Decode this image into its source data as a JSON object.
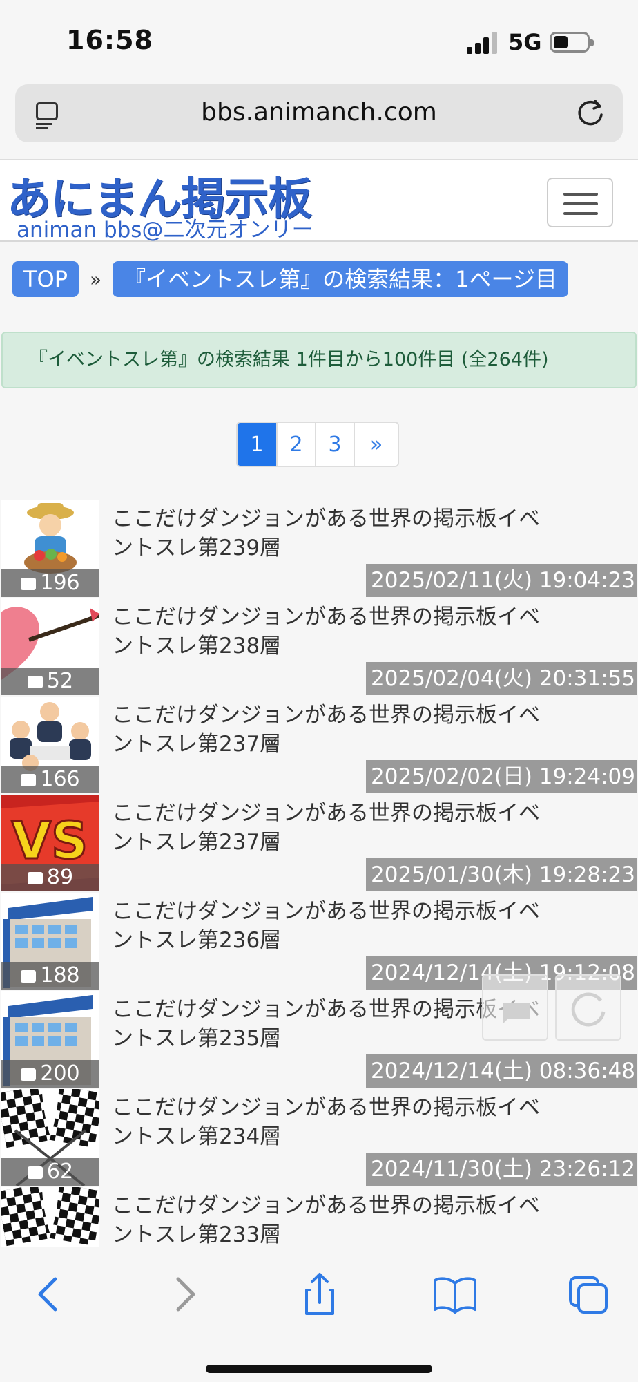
{
  "status": {
    "time": "16:58",
    "network": "5G"
  },
  "browser": {
    "url": "bbs.animanch.com"
  },
  "site": {
    "title": "あにまん掲示板",
    "subtitle": "animan bbs@二次元オンリー"
  },
  "breadcrumb": {
    "top": "TOP",
    "separator": "»",
    "current": "『イベントスレ第』の検索結果：1ページ目"
  },
  "alert": "『イベントスレ第』の検索結果 1件目から100件目 (全264件)",
  "pagination": {
    "pages": [
      "1",
      "2",
      "3"
    ],
    "next": "»",
    "active": "1"
  },
  "threads": [
    {
      "title": "ここだけダンジョンがある世界の掲示板イベントスレ第239層",
      "count": "196",
      "date": "2025/02/11(火) 19:04:23",
      "thumb": "farmer-icon"
    },
    {
      "title": "ここだけダンジョンがある世界の掲示板イベントスレ第238層",
      "count": "52",
      "date": "2025/02/04(火) 20:31:55",
      "thumb": "heart-arrow-icon"
    },
    {
      "title": "ここだけダンジョンがある世界の掲示板イベントスレ第237層",
      "count": "166",
      "date": "2025/02/02(日) 19:24:09",
      "thumb": "meeting-icon"
    },
    {
      "title": "ここだけダンジョンがある世界の掲示板イベントスレ第237層",
      "count": "89",
      "date": "2025/01/30(木) 19:28:23",
      "thumb": "vs-icon"
    },
    {
      "title": "ここだけダンジョンがある世界の掲示板イベントスレ第236層",
      "count": "188",
      "date": "2024/12/14(土) 19:12:08",
      "thumb": "department-store-icon"
    },
    {
      "title": "ここだけダンジョンがある世界の掲示板イベントスレ第235層",
      "count": "200",
      "date": "2024/12/14(土) 08:36:48",
      "thumb": "department-store-icon"
    },
    {
      "title": "ここだけダンジョンがある世界の掲示板イベントスレ第234層",
      "count": "62",
      "date": "2024/11/30(土) 23:26:12",
      "thumb": "checkered-flag-icon"
    },
    {
      "title": "ここだけダンジョンがある世界の掲示板イベントスレ第233層",
      "count": "",
      "date": "",
      "thumb": "checkered-flag-icon"
    }
  ],
  "colors": {
    "brand": "#2f62c9",
    "crumb": "#4a85e6",
    "active_page": "#1f74ea",
    "alert_bg": "#d7ecdf"
  }
}
